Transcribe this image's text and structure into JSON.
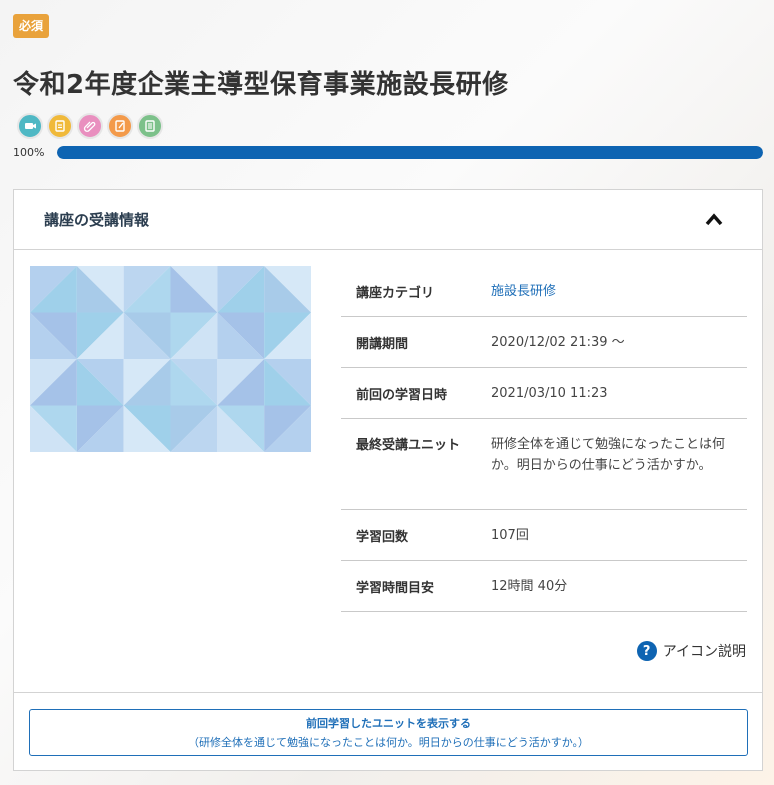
{
  "badge": "必須",
  "course": {
    "title": "令和2年度企業主導型保育事業施設長研修",
    "progress_label": "100%",
    "progress": 100
  },
  "type_icons": [
    {
      "name": "video-icon",
      "color": "#4fb8c4"
    },
    {
      "name": "document-icon",
      "color": "#f0b93a"
    },
    {
      "name": "attachment-icon",
      "color": "#e98fbf"
    },
    {
      "name": "report-icon",
      "color": "#f39a4a"
    },
    {
      "name": "test-icon",
      "color": "#7cc18a"
    }
  ],
  "info": {
    "header": "講座の受講情報",
    "rows": [
      {
        "label": "講座カテゴリ",
        "value": "施設長研修"
      },
      {
        "label": "開講期間",
        "value": "2020/12/02 21:39 ～"
      },
      {
        "label": "前回の学習日時",
        "value": "2021/03/10 11:23"
      },
      {
        "label": "最終受講ユニット",
        "value": "研修全体を通じて勉強になったことは何か。明日からの仕事にどう活かすか。"
      },
      {
        "label": "学習回数",
        "value": "107回"
      },
      {
        "label": "学習時間目安",
        "value": "12時間 40分"
      }
    ],
    "help_label": "アイコン説明",
    "help_symbol": "?"
  },
  "resume": {
    "main": "前回学習したユニットを表示する",
    "sub": "（研修全体を通じて勉強になったことは何か。明日からの仕事にどう活かすか。）"
  },
  "colors": {
    "accent": "#0e64b2",
    "badge": "#e9a23b",
    "link": "#1f6fb8"
  }
}
